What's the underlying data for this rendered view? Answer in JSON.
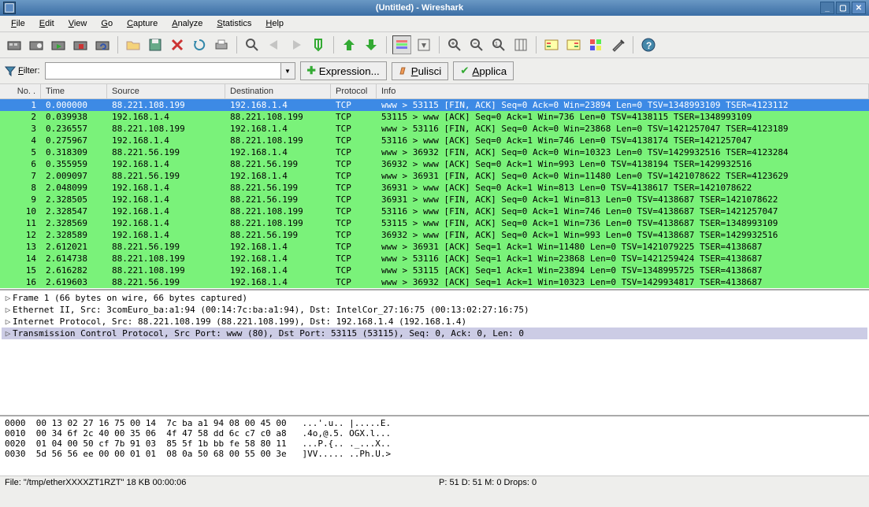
{
  "title": "(Untitled) - Wireshark",
  "menu": [
    "File",
    "Edit",
    "View",
    "Go",
    "Capture",
    "Analyze",
    "Statistics",
    "Help"
  ],
  "filter": {
    "label": "Filter:",
    "value": "",
    "expr_btn": "Expression...",
    "clear_btn": "Pulisci",
    "apply_btn": "Applica"
  },
  "columns": {
    "no": "No. .",
    "time": "Time",
    "source": "Source",
    "destination": "Destination",
    "protocol": "Protocol",
    "info": "Info"
  },
  "packets": [
    {
      "no": "1",
      "time": "0.000000",
      "src": "88.221.108.199",
      "dst": "192.168.1.4",
      "proto": "TCP",
      "info": "www > 53115 [FIN, ACK] Seq=0 Ack=0 Win=23894 Len=0 TSV=1348993109 TSER=4123112",
      "sel": true
    },
    {
      "no": "2",
      "time": "0.039938",
      "src": "192.168.1.4",
      "dst": "88.221.108.199",
      "proto": "TCP",
      "info": "53115 > www [ACK] Seq=0 Ack=1 Win=736 Len=0 TSV=4138115 TSER=1348993109"
    },
    {
      "no": "3",
      "time": "0.236557",
      "src": "88.221.108.199",
      "dst": "192.168.1.4",
      "proto": "TCP",
      "info": "www > 53116 [FIN, ACK] Seq=0 Ack=0 Win=23868 Len=0 TSV=1421257047 TSER=4123189"
    },
    {
      "no": "4",
      "time": "0.275967",
      "src": "192.168.1.4",
      "dst": "88.221.108.199",
      "proto": "TCP",
      "info": "53116 > www [ACK] Seq=0 Ack=1 Win=746 Len=0 TSV=4138174 TSER=1421257047"
    },
    {
      "no": "5",
      "time": "0.318309",
      "src": "88.221.56.199",
      "dst": "192.168.1.4",
      "proto": "TCP",
      "info": "www > 36932 [FIN, ACK] Seq=0 Ack=0 Win=10323 Len=0 TSV=1429932516 TSER=4123284"
    },
    {
      "no": "6",
      "time": "0.355959",
      "src": "192.168.1.4",
      "dst": "88.221.56.199",
      "proto": "TCP",
      "info": "36932 > www [ACK] Seq=0 Ack=1 Win=993 Len=0 TSV=4138194 TSER=1429932516"
    },
    {
      "no": "7",
      "time": "2.009097",
      "src": "88.221.56.199",
      "dst": "192.168.1.4",
      "proto": "TCP",
      "info": "www > 36931 [FIN, ACK] Seq=0 Ack=0 Win=11480 Len=0 TSV=1421078622 TSER=4123629"
    },
    {
      "no": "8",
      "time": "2.048099",
      "src": "192.168.1.4",
      "dst": "88.221.56.199",
      "proto": "TCP",
      "info": "36931 > www [ACK] Seq=0 Ack=1 Win=813 Len=0 TSV=4138617 TSER=1421078622"
    },
    {
      "no": "9",
      "time": "2.328505",
      "src": "192.168.1.4",
      "dst": "88.221.56.199",
      "proto": "TCP",
      "info": "36931 > www [FIN, ACK] Seq=0 Ack=1 Win=813 Len=0 TSV=4138687 TSER=1421078622"
    },
    {
      "no": "10",
      "time": "2.328547",
      "src": "192.168.1.4",
      "dst": "88.221.108.199",
      "proto": "TCP",
      "info": "53116 > www [FIN, ACK] Seq=0 Ack=1 Win=746 Len=0 TSV=4138687 TSER=1421257047"
    },
    {
      "no": "11",
      "time": "2.328569",
      "src": "192.168.1.4",
      "dst": "88.221.108.199",
      "proto": "TCP",
      "info": "53115 > www [FIN, ACK] Seq=0 Ack=1 Win=736 Len=0 TSV=4138687 TSER=1348993109"
    },
    {
      "no": "12",
      "time": "2.328589",
      "src": "192.168.1.4",
      "dst": "88.221.56.199",
      "proto": "TCP",
      "info": "36932 > www [FIN, ACK] Seq=0 Ack=1 Win=993 Len=0 TSV=4138687 TSER=1429932516"
    },
    {
      "no": "13",
      "time": "2.612021",
      "src": "88.221.56.199",
      "dst": "192.168.1.4",
      "proto": "TCP",
      "info": "www > 36931 [ACK] Seq=1 Ack=1 Win=11480 Len=0 TSV=1421079225 TSER=4138687"
    },
    {
      "no": "14",
      "time": "2.614738",
      "src": "88.221.108.199",
      "dst": "192.168.1.4",
      "proto": "TCP",
      "info": "www > 53116 [ACK] Seq=1 Ack=1 Win=23868 Len=0 TSV=1421259424 TSER=4138687"
    },
    {
      "no": "15",
      "time": "2.616282",
      "src": "88.221.108.199",
      "dst": "192.168.1.4",
      "proto": "TCP",
      "info": "www > 53115 [ACK] Seq=1 Ack=1 Win=23894 Len=0 TSV=1348995725 TSER=4138687"
    },
    {
      "no": "16",
      "time": "2.619603",
      "src": "88.221.56.199",
      "dst": "192.168.1.4",
      "proto": "TCP",
      "info": "www > 36932 [ACK] Seq=1 Ack=1 Win=10323 Len=0 TSV=1429934817 TSER=4138687"
    }
  ],
  "details": [
    {
      "text": "Frame 1 (66 bytes on wire, 66 bytes captured)"
    },
    {
      "text": "Ethernet II, Src: 3comEuro_ba:a1:94 (00:14:7c:ba:a1:94), Dst: IntelCor_27:16:75 (00:13:02:27:16:75)"
    },
    {
      "text": "Internet Protocol, Src: 88.221.108.199 (88.221.108.199), Dst: 192.168.1.4 (192.168.1.4)"
    },
    {
      "text": "Transmission Control Protocol, Src Port: www (80), Dst Port: 53115 (53115), Seq: 0, Ack: 0, Len: 0",
      "hl": true
    }
  ],
  "hex": [
    {
      "off": "0000",
      "b": "00 13 02 27 16 75 00 14  7c ba a1 94 08 00 45 00",
      "a": "...'.u.. |.....E."
    },
    {
      "off": "0010",
      "b": "00 34 6f 2c 40 00 35 06  4f 47 58 dd 6c c7 c0 a8",
      "a": ".4o,@.5. OGX.l..."
    },
    {
      "off": "0020",
      "b": "01 04 00 50 cf 7b 91 03  85 5f 1b bb fe 58 80 11",
      "a": "...P.{.. ._...X.."
    },
    {
      "off": "0030",
      "b": "5d 56 56 ee 00 00 01 01  08 0a 50 68 00 55 00 3e",
      "a": "]VV..... ..Ph.U.>"
    }
  ],
  "status": {
    "left": "File: \"/tmp/etherXXXXZT1RZT\" 18 KB 00:00:06",
    "mid": "P: 51 D: 51 M: 0 Drops: 0",
    "right": ""
  }
}
